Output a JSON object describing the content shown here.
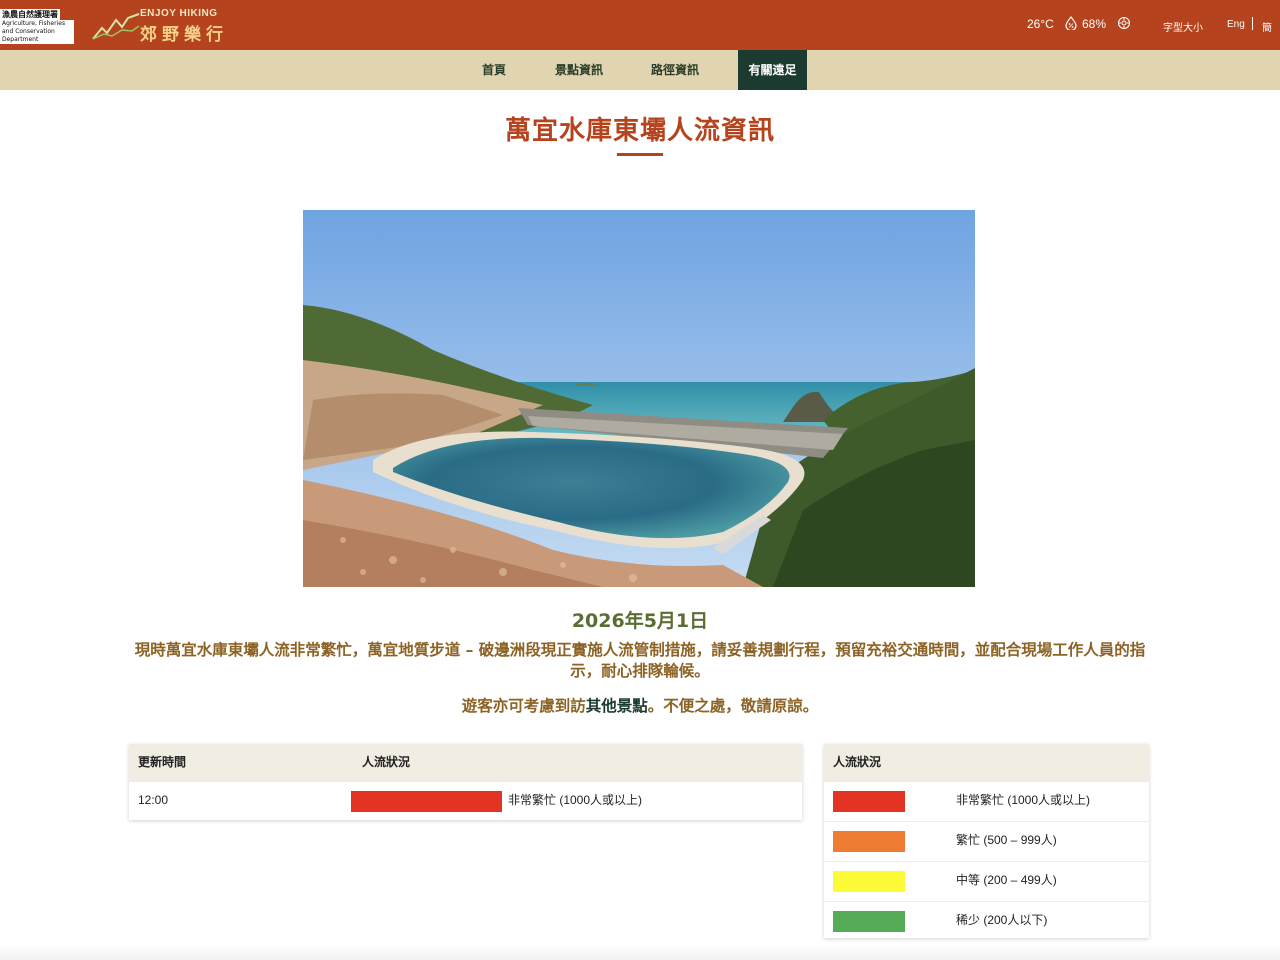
{
  "header": {
    "afcd_cn": "漁農自然護理署",
    "afcd_en": "Agriculture, Fisheries and Conservation Department",
    "brand_en": "ENJOY HIKING",
    "brand_cn": "郊野樂行",
    "temperature": "26°C",
    "humidity": "68%",
    "font_size_label": "字型大小",
    "lang_en": "Eng",
    "lang_sc": "簡",
    "icons": [
      "humidity-icon",
      "uv-icon"
    ]
  },
  "nav": {
    "items": [
      {
        "label": "首頁"
      },
      {
        "label": "景點資訊"
      },
      {
        "label": "路徑資訊"
      },
      {
        "label": "有關遠足"
      }
    ]
  },
  "page": {
    "title": "萬宜水庫東壩人流資訊",
    "date": "2026年5月1日",
    "notice": "現時萬宜水庫東壩人流非常繁忙，萬宜地質步道 – 破邊洲段現正實施人流管制措施，請妥善規劃行程，預留充裕交通時間，並配合現場工作人員的指示，耐心排隊輪候。",
    "notice2_before": "遊客亦可考慮到訪",
    "notice2_link": "其他景點",
    "notice2_after": "。不便之處，敬請原諒。"
  },
  "status_table": {
    "col_time": "更新時間",
    "col_status": "人流狀況",
    "rows": [
      {
        "time": "12:00",
        "color": "#e23323",
        "label": "非常繁忙 (1000人或以上)"
      }
    ]
  },
  "legend_table": {
    "header": "人流狀況",
    "rows": [
      {
        "color": "#e23323",
        "label": "非常繁忙 (1000人或以上)"
      },
      {
        "color": "#ee7d33",
        "label": "繁忙 (500 – 999人)"
      },
      {
        "color": "#fdfb38",
        "label": "中等 (200 – 499人)"
      },
      {
        "color": "#56ab56",
        "label": "稀少 (200人以下)"
      }
    ]
  }
}
